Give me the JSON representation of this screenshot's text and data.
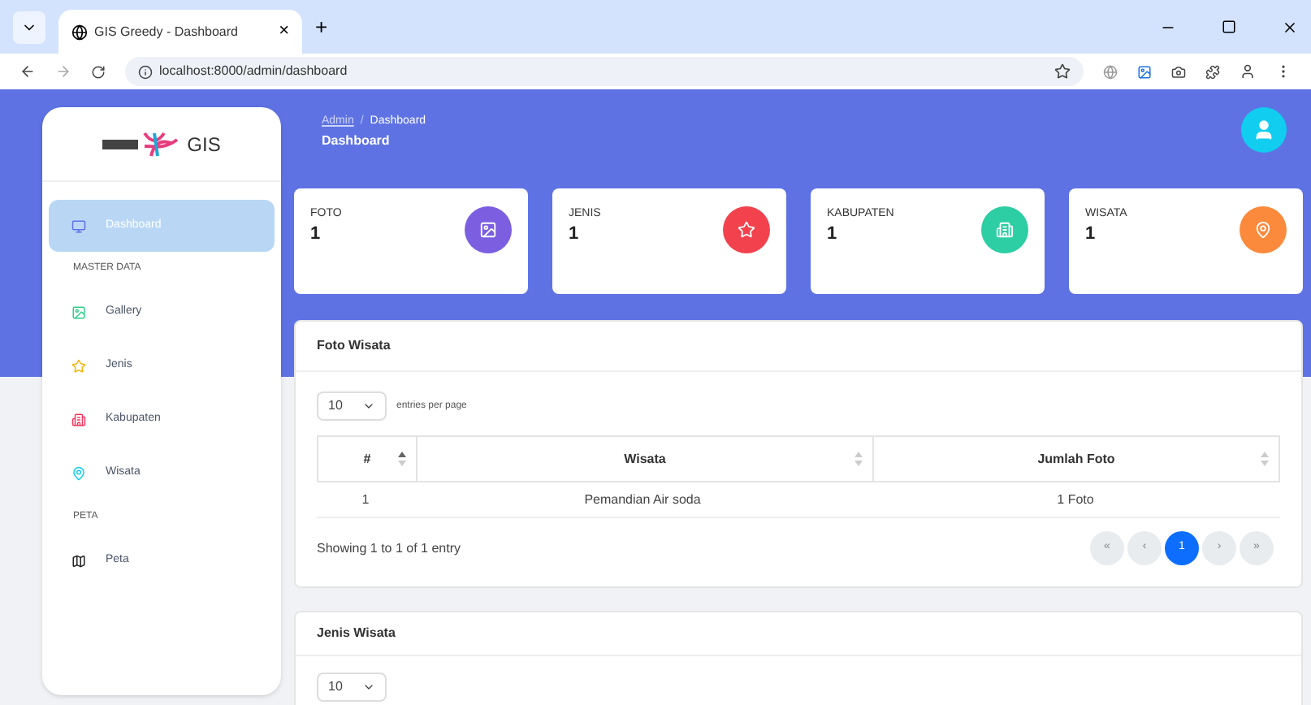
{
  "browser": {
    "tab_title": "GIS Greedy - Dashboard",
    "url": "localhost:8000/admin/dashboard",
    "tab_close": "×",
    "new_tab": "+"
  },
  "sidebar": {
    "logo_text": "GIS",
    "sections": [
      {
        "items": [
          {
            "label": "Dashboard",
            "kind": "monitor",
            "selected": true
          }
        ]
      },
      {
        "heading": "MASTER DATA",
        "items": [
          {
            "label": "Gallery",
            "kind": "image",
            "selected": false
          },
          {
            "label": "Jenis",
            "kind": "star",
            "selected": false
          },
          {
            "label": "Kabupaten",
            "kind": "building",
            "selected": false
          },
          {
            "label": "Wisata",
            "kind": "pin",
            "selected": false
          }
        ]
      },
      {
        "heading": "PETA",
        "items": [
          {
            "label": "Peta",
            "kind": "map",
            "selected": false
          }
        ]
      }
    ]
  },
  "header": {
    "breadcrumb": [
      "Admin",
      "Dashboard"
    ],
    "separator": "/",
    "title": "Dashboard"
  },
  "stats": [
    {
      "label": "FOTO",
      "value": "1",
      "kind": "image",
      "color": "#7b5fe0"
    },
    {
      "label": "JENIS",
      "value": "1",
      "kind": "star",
      "color": "#f2424e"
    },
    {
      "label": "KABUPATEN",
      "value": "1",
      "kind": "building",
      "color": "#2dcea3"
    },
    {
      "label": "WISATA",
      "value": "1",
      "kind": "pin",
      "color": "#fb8a3c"
    }
  ],
  "foto_wisata": {
    "title": "Foto Wisata",
    "page_size": "10",
    "page_size_label": "entries per page",
    "columns": [
      "#",
      "Wisata",
      "Jumlah Foto"
    ],
    "rows": [
      [
        "1",
        "Pemandian Air soda",
        "1 Foto"
      ]
    ],
    "info": "Showing 1 to 1 of 1 entry",
    "pagination": [
      {
        "label": "«",
        "selected": false
      },
      {
        "label": "‹",
        "selected": false
      },
      {
        "label": "1",
        "selected": true
      },
      {
        "label": "›",
        "selected": false
      },
      {
        "label": "»",
        "selected": false
      }
    ]
  },
  "jenis_wisata": {
    "title": "Jenis Wisata",
    "page_size": "10"
  }
}
